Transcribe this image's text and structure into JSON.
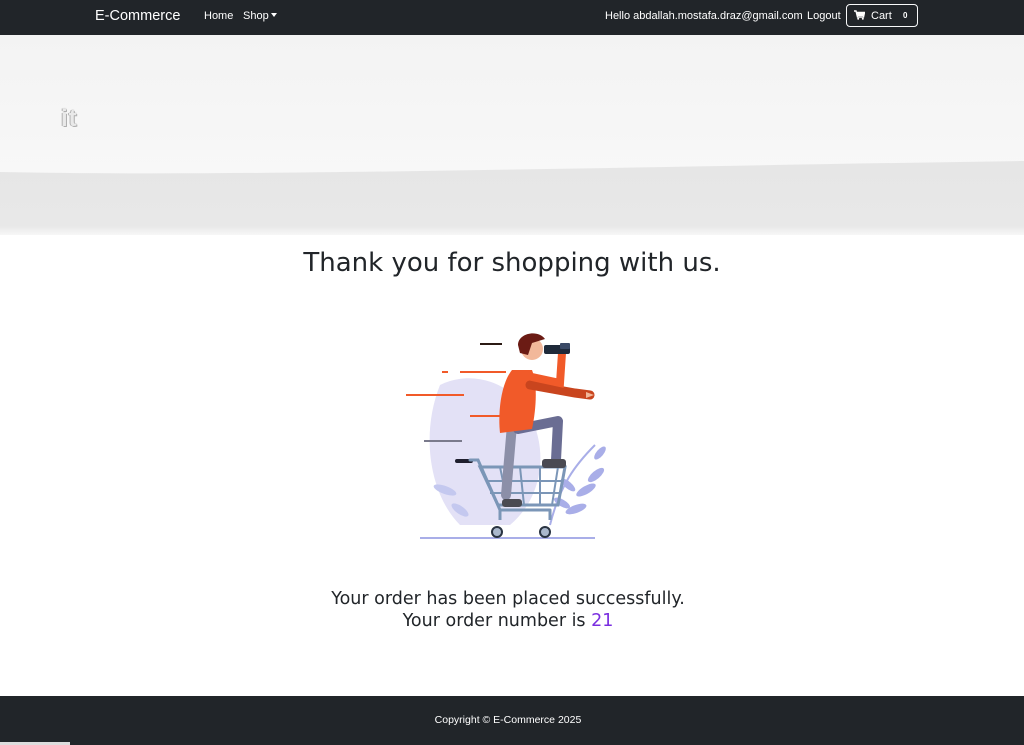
{
  "navbar": {
    "brand": "E-Commerce",
    "links": {
      "home": "Home",
      "shop": "Shop"
    },
    "greeting": "Hello abdallah.mostafa.draz@gmail.com",
    "logout": "Logout",
    "cart": {
      "label": "Cart",
      "count": "0",
      "icon": "cart-icon"
    }
  },
  "hero": {
    "text": "it"
  },
  "main": {
    "heading": "Thank you for shopping with us.",
    "order_message": "Your order has been placed successfully.",
    "order_number_label": "Your order number is",
    "order_number": "21",
    "illustration": "person-in-shopping-cart-with-binoculars"
  },
  "footer": {
    "copyright": "Copyright © E-Commerce 2025"
  },
  "colors": {
    "navbar_bg": "#212529",
    "order_number": "#7a2ee0",
    "accent_orange": "#f15a29",
    "cart_blue": "#7b96b7"
  }
}
